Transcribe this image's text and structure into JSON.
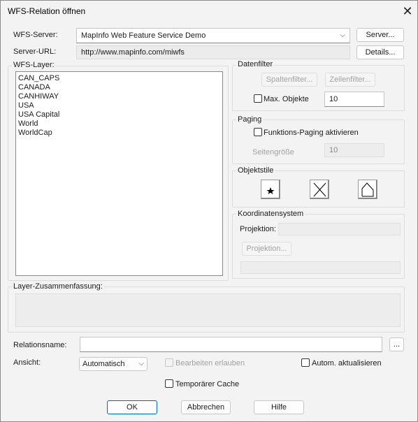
{
  "window": {
    "title": "WFS-Relation öffnen",
    "close_icon": "close-icon"
  },
  "server": {
    "label": "WFS-Server:",
    "selected": "MapInfo Web Feature Service Demo",
    "server_button": "Server...",
    "url_label": "Server-URL:",
    "url_value": "http://www.mapinfo.com/miwfs",
    "details_button": "Details..."
  },
  "layers": {
    "label": "WFS-Layer:",
    "items": [
      "CAN_CAPS",
      "CANADA",
      "CANHIWAY",
      "USA",
      "USA Capital",
      "World",
      "WorldCap"
    ]
  },
  "datenfilter": {
    "title": "Datenfilter",
    "column_filter_button": "Spaltenfilter...",
    "row_filter_button": "Zeilenfilter...",
    "max_objects_label": "Max. Objekte",
    "max_objects_value": "10"
  },
  "paging": {
    "title": "Paging",
    "enable_label": "Funktions-Paging aktivieren",
    "page_size_label": "Seitengröße",
    "page_size_value": "10"
  },
  "objektstile": {
    "title": "Objektstile",
    "icons": [
      "symbol-style-icon",
      "line-style-icon",
      "region-style-icon"
    ]
  },
  "koordinaten": {
    "title": "Koordinatensystem",
    "projection_label": "Projektion:",
    "projection_value": "",
    "projection_button": "Projektion...",
    "extra_value": ""
  },
  "summary": {
    "label": "Layer-Zusammenfassung:",
    "value": ""
  },
  "bottom": {
    "relation_name_label": "Relationsname:",
    "relation_name_value": "",
    "browse_button": "...",
    "view_label": "Ansicht:",
    "view_selected": "Automatisch",
    "edit_allow_label": "Bearbeiten erlauben",
    "auto_update_label": "Autom. aktualisieren",
    "temp_cache_label": "Temporärer Cache"
  },
  "buttons": {
    "ok": "OK",
    "cancel": "Abbrechen",
    "help": "Hilfe"
  }
}
